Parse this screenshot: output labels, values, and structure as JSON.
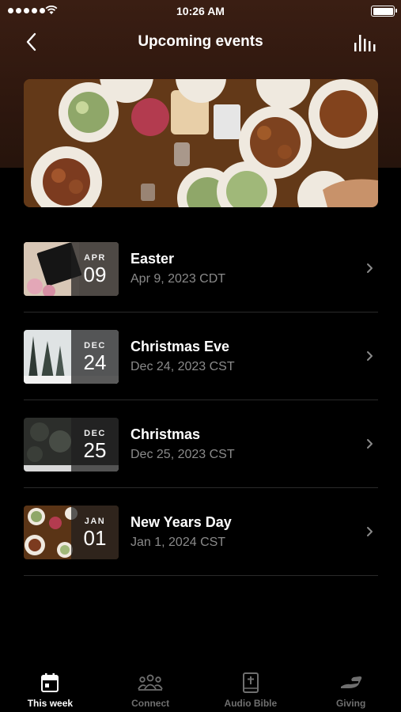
{
  "status_bar": {
    "time": "10:26 AM"
  },
  "header": {
    "title": "Upcoming events"
  },
  "events": [
    {
      "title": "Easter",
      "date": "Apr 9, 2023 CDT",
      "month": "APR",
      "day": "09"
    },
    {
      "title": "Christmas Eve",
      "date": "Dec 24, 2023 CST",
      "month": "DEC",
      "day": "24"
    },
    {
      "title": "Christmas",
      "date": "Dec 25, 2023 CST",
      "month": "DEC",
      "day": "25"
    },
    {
      "title": "New Years Day",
      "date": "Jan 1, 2024 CST",
      "month": "JAN",
      "day": "01"
    }
  ],
  "tab_bar": {
    "tabs": [
      {
        "label": "This week",
        "icon": "calendar-icon",
        "active": true
      },
      {
        "label": "Connect",
        "icon": "people-icon",
        "active": false
      },
      {
        "label": "Audio Bible",
        "icon": "bible-icon",
        "active": false
      },
      {
        "label": "Giving",
        "icon": "hand-icon",
        "active": false
      }
    ]
  },
  "colors": {
    "header_bg": "#3a1e13",
    "background": "#000000",
    "muted_text": "#8a8a8a",
    "inactive_tab": "#6f6f6f"
  }
}
